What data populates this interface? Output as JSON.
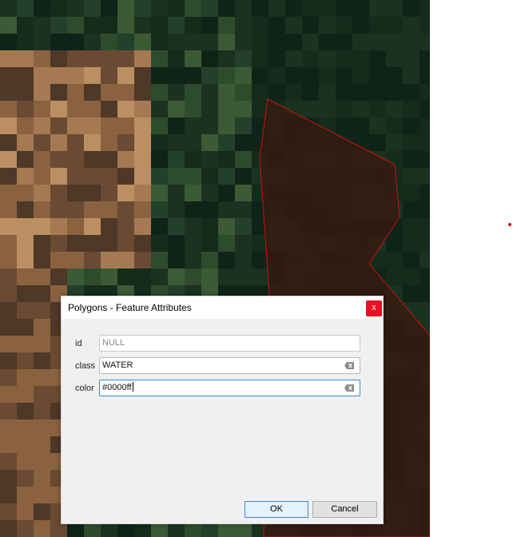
{
  "dialog": {
    "title": "Polygons - Feature Attributes",
    "close_label": "x",
    "fields": [
      {
        "label": "id",
        "value": "NULL",
        "is_null": true
      },
      {
        "label": "class",
        "value": "WATER",
        "is_null": false
      },
      {
        "label": "color",
        "value": "#0000ff",
        "is_null": false,
        "focused": true
      }
    ],
    "ok_label": "OK",
    "cancel_label": "Cancel"
  },
  "map": {
    "polygon_stroke_color": "#cc1111",
    "polygon_fill_color": "#3a1810",
    "raster_palette": [
      "#0f2418",
      "#142c1c",
      "#1a3220",
      "#24402a",
      "#2e4c2c",
      "#3c5a34",
      "#4e3828",
      "#6a4a32",
      "#8a6240",
      "#a57a52",
      "#bb8f62",
      "#5c4630"
    ]
  }
}
